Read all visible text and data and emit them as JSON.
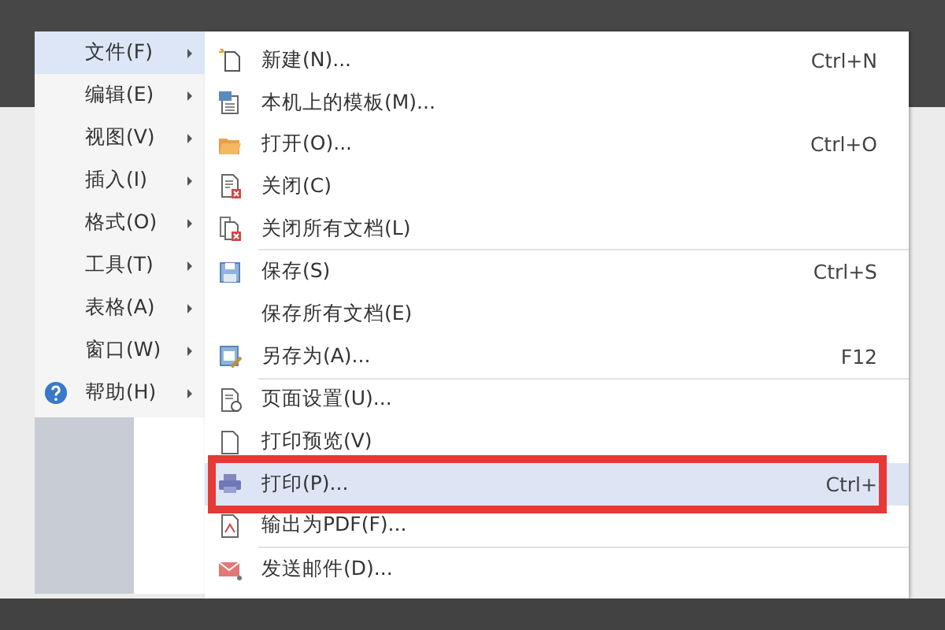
{
  "main_menu": [
    {
      "label": "文件(F)",
      "selected": true,
      "kind": "plain"
    },
    {
      "label": "编辑(E)",
      "selected": false,
      "kind": "plain"
    },
    {
      "label": "视图(V)",
      "selected": false,
      "kind": "plain"
    },
    {
      "label": "插入(I)",
      "selected": false,
      "kind": "plain"
    },
    {
      "label": "格式(O)",
      "selected": false,
      "kind": "plain"
    },
    {
      "label": "工具(T)",
      "selected": false,
      "kind": "plain"
    },
    {
      "label": "表格(A)",
      "selected": false,
      "kind": "plain"
    },
    {
      "label": "窗口(W)",
      "selected": false,
      "kind": "plain"
    },
    {
      "label": "帮助(H)",
      "selected": false,
      "kind": "help"
    }
  ],
  "file_menu": {
    "groups": [
      [
        {
          "label": "新建(N)...",
          "shortcut": "Ctrl+N",
          "kind": "new",
          "selected": false,
          "framed": false
        },
        {
          "label": "本机上的模板(M)...",
          "kind": "template",
          "selected": false,
          "framed": false
        },
        {
          "label": "打开(O)...",
          "shortcut": "Ctrl+O",
          "kind": "open",
          "selected": false,
          "framed": false
        },
        {
          "label": "关闭(C)",
          "kind": "close",
          "selected": false,
          "framed": false
        },
        {
          "label": "关闭所有文档(L)",
          "kind": "close-all",
          "selected": false,
          "framed": false
        }
      ],
      [
        {
          "label": "保存(S)",
          "shortcut": "Ctrl+S",
          "kind": "save",
          "selected": false,
          "framed": false
        },
        {
          "label": "保存所有文档(E)",
          "kind": "none",
          "selected": false,
          "framed": false
        },
        {
          "label": "另存为(A)...",
          "shortcut": "F12",
          "kind": "save-as",
          "selected": false,
          "framed": false
        }
      ],
      [
        {
          "label": "页面设置(U)...",
          "kind": "page-setup",
          "selected": false,
          "framed": false
        },
        {
          "label": "打印预览(V)",
          "kind": "preview",
          "selected": false,
          "framed": false
        },
        {
          "label": "打印(P)...",
          "shortcut": "Ctrl+",
          "kind": "print",
          "selected": true,
          "framed": true
        },
        {
          "label": "输出为PDF(F)...",
          "kind": "pdf",
          "selected": false,
          "framed": false
        }
      ],
      [
        {
          "label": "发送邮件(D)...",
          "kind": "mail",
          "selected": false,
          "framed": false
        }
      ]
    ]
  }
}
